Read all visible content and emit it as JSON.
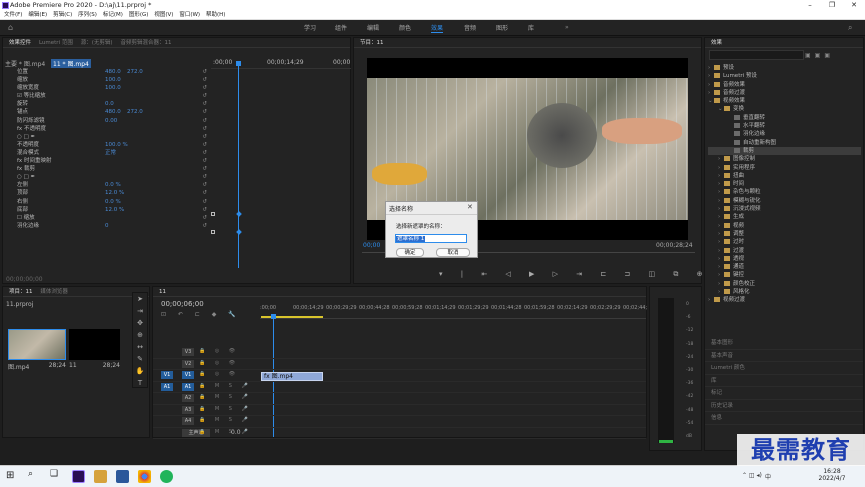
{
  "window": {
    "title": "Adobe Premiere Pro 2020 - D:\\aj\\11.prproj *",
    "controls": [
      "–",
      "❐",
      "✕"
    ]
  },
  "menu": [
    "文件(F)",
    "编辑(E)",
    "剪辑(C)",
    "序列(S)",
    "标记(M)",
    "图形(G)",
    "视图(V)",
    "窗口(W)",
    "帮助(H)"
  ],
  "workspaces": [
    "学习",
    "组件",
    "编辑",
    "颜色",
    "效果",
    "音频",
    "图形",
    "库"
  ],
  "workspace_active": "效果",
  "effect_controls": {
    "tabs": [
      "效果控件",
      "Lumetri 范围",
      "源：(无剪辑)",
      "音频剪辑混合器：11"
    ],
    "master": "主要 * 图.mp4",
    "seq": "11 * 图.mp4",
    "ruler": [
      ":00;00",
      "00;00;14;29",
      "00;00"
    ],
    "rows": [
      {
        "label": "位置",
        "v": "480.0",
        "v2": "272.0"
      },
      {
        "label": "缩放",
        "v": "100.0"
      },
      {
        "label": "缩放宽度",
        "v": "100.0"
      },
      {
        "label": "☑ 等比缩放",
        "v": ""
      },
      {
        "label": "旋转",
        "v": "0.0"
      },
      {
        "label": "锚点",
        "v": "480.0",
        "v2": "272.0"
      },
      {
        "label": "防闪烁滤镜",
        "v": "0.00"
      },
      {
        "label": "fx 不透明度",
        "v": ""
      },
      {
        "label": "○ □ ✒",
        "v": ""
      },
      {
        "label": "不透明度",
        "v": "100.0 %"
      },
      {
        "label": "混合模式",
        "v": "正常"
      },
      {
        "label": "fx 时间重映射",
        "v": ""
      },
      {
        "label": "fx 裁剪",
        "v": ""
      },
      {
        "label": "○ □ ✒",
        "v": ""
      },
      {
        "label": "左侧",
        "v": "0.0 %"
      },
      {
        "label": "顶部",
        "v": "12.0 %"
      },
      {
        "label": "右侧",
        "v": "0.0 %"
      },
      {
        "label": "底部",
        "v": "12.0 %"
      },
      {
        "label": "☐ 缩放",
        "v": ""
      },
      {
        "label": "羽化边缘",
        "v": "0"
      }
    ],
    "timecode": "00;00;00;00"
  },
  "program": {
    "tab": "节目：11",
    "timecode_left": "00;00",
    "timecode_right": "00;00;28;24",
    "video_desc": "caged bird being touched by a hand"
  },
  "dialog": {
    "title": "选择名称",
    "close": "✕",
    "prompt": "选择新遮罩的名称：",
    "value": "遮罩名称 1",
    "ok": "确定",
    "cancel": "取消"
  },
  "project": {
    "tabs": [
      "项目：11",
      "媒体浏览器"
    ],
    "file": "11.prproj",
    "items": [
      {
        "name": "图.mp4",
        "dur": "28;24"
      },
      {
        "name": "11",
        "dur": "28;24"
      }
    ]
  },
  "timeline": {
    "tab": "11",
    "timecode": "00;00;06;00",
    "ruler": [
      ":00;00",
      "00;00;14;29",
      "00;00;29;29",
      "00;00;44;28",
      "00;00;59;28",
      "00;01;14;29",
      "00;01;29;29",
      "00;01;44;28",
      "00;01;59;28",
      "00;02;14;29",
      "00;02;29;29",
      "00;02;44;"
    ],
    "tracks": [
      "V3",
      "V2",
      "V1",
      "A1",
      "A2",
      "A3",
      "A4",
      "主声道"
    ],
    "src": [
      "V1",
      "A1"
    ],
    "clip": "fx 图.mp4",
    "master_val": "0.0"
  },
  "meter": {
    "scale": [
      "0",
      "-6",
      "-12",
      "-18",
      "-24",
      "-30",
      "-36",
      "-42",
      "-48",
      "-54",
      "dB"
    ]
  },
  "effects": {
    "title": "效果",
    "items": [
      {
        "t": "预设",
        "d": 0,
        "a": "›"
      },
      {
        "t": "Lumetri 预设",
        "d": 0,
        "a": "›"
      },
      {
        "t": "音频效果",
        "d": 0,
        "a": "›"
      },
      {
        "t": "音频过渡",
        "d": 0,
        "a": "›"
      },
      {
        "t": "视频效果",
        "d": 0,
        "a": "⌄"
      },
      {
        "t": "变换",
        "d": 1,
        "a": "⌄"
      },
      {
        "t": "垂直翻转",
        "d": 2,
        "a": ""
      },
      {
        "t": "水平翻转",
        "d": 2,
        "a": ""
      },
      {
        "t": "羽化边缘",
        "d": 2,
        "a": ""
      },
      {
        "t": "自动重新构图",
        "d": 2,
        "a": ""
      },
      {
        "t": "裁剪",
        "d": 2,
        "a": "",
        "sel": true
      },
      {
        "t": "图像控制",
        "d": 1,
        "a": "›"
      },
      {
        "t": "实用程序",
        "d": 1,
        "a": "›"
      },
      {
        "t": "扭曲",
        "d": 1,
        "a": "›"
      },
      {
        "t": "时间",
        "d": 1,
        "a": "›"
      },
      {
        "t": "杂色与颗粒",
        "d": 1,
        "a": "›"
      },
      {
        "t": "模糊与锐化",
        "d": 1,
        "a": "›"
      },
      {
        "t": "沉浸式视频",
        "d": 1,
        "a": "›"
      },
      {
        "t": "生成",
        "d": 1,
        "a": "›"
      },
      {
        "t": "视频",
        "d": 1,
        "a": "›"
      },
      {
        "t": "调整",
        "d": 1,
        "a": "›"
      },
      {
        "t": "过时",
        "d": 1,
        "a": "›"
      },
      {
        "t": "过渡",
        "d": 1,
        "a": "›"
      },
      {
        "t": "透视",
        "d": 1,
        "a": "›"
      },
      {
        "t": "通道",
        "d": 1,
        "a": "›"
      },
      {
        "t": "键控",
        "d": 1,
        "a": "›"
      },
      {
        "t": "颜色校正",
        "d": 1,
        "a": "›"
      },
      {
        "t": "风格化",
        "d": 1,
        "a": "›"
      },
      {
        "t": "视频过渡",
        "d": 0,
        "a": "›"
      }
    ],
    "libs": [
      "基本图形",
      "基本声音",
      "Lumetri 颜色",
      "库",
      "标记",
      "历史记录",
      "信息"
    ]
  },
  "taskbar": {
    "time": "16:28",
    "date": "2022/4/7",
    "ime": "中"
  },
  "watermark": "最需教育"
}
